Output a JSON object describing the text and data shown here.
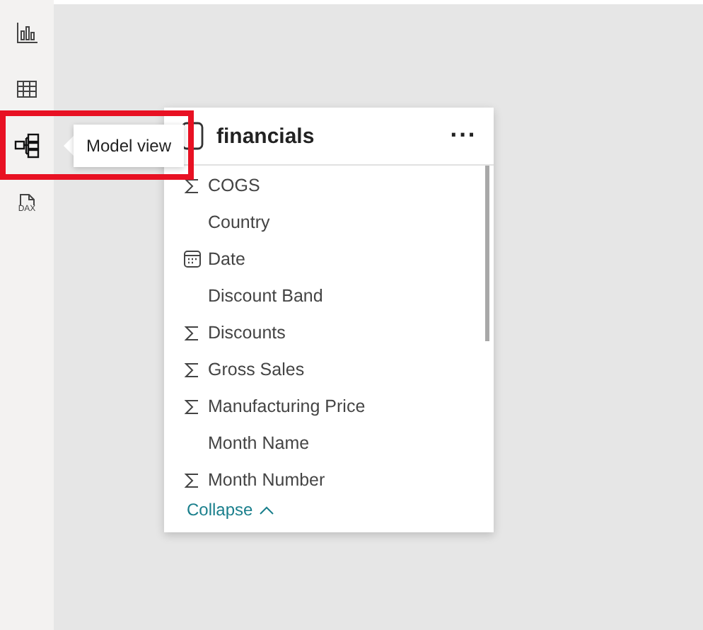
{
  "nav": [
    {
      "kind": "report",
      "selected": false
    },
    {
      "kind": "table",
      "selected": false
    },
    {
      "kind": "model",
      "selected": true
    },
    {
      "kind": "dax",
      "label": "DAX",
      "selected": false
    }
  ],
  "tooltip": {
    "text": "Model view"
  },
  "table_card": {
    "title": "financials",
    "more": "···",
    "fields": [
      {
        "kind": "sum",
        "name": "COGS"
      },
      {
        "kind": "text",
        "name": "Country"
      },
      {
        "kind": "date",
        "name": "Date"
      },
      {
        "kind": "text",
        "name": "Discount Band"
      },
      {
        "kind": "sum",
        "name": "Discounts"
      },
      {
        "kind": "sum",
        "name": "Gross Sales"
      },
      {
        "kind": "sum",
        "name": "Manufacturing Price"
      },
      {
        "kind": "text",
        "name": "Month Name"
      },
      {
        "kind": "sum",
        "name": "Month Number"
      }
    ],
    "collapse": "Collapse"
  }
}
